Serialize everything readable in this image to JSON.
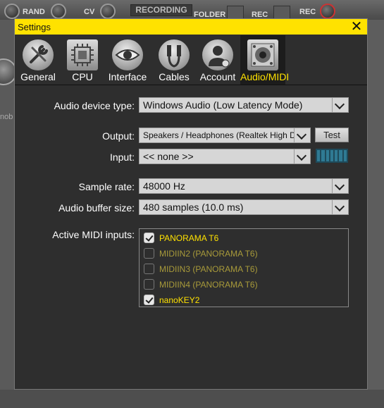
{
  "background": {
    "rand_label": "RAND",
    "cv_label": "CV",
    "recording_label": "RECORDING",
    "folder_label": "FOLDER",
    "rec_label_1": "REC",
    "rec_label_2": "REC",
    "left_partial_text": "nob"
  },
  "dialog": {
    "title": "Settings",
    "close_glyph": "✕",
    "tabs": [
      {
        "label": "General",
        "icon": "wrench-screwdriver-icon",
        "selected": false
      },
      {
        "label": "CPU",
        "icon": "cpu-chip-icon",
        "selected": false
      },
      {
        "label": "Interface",
        "icon": "eye-icon",
        "selected": false
      },
      {
        "label": "Cables",
        "icon": "cables-icon",
        "selected": false
      },
      {
        "label": "Account",
        "icon": "user-account-icon",
        "selected": false
      },
      {
        "label": "Audio/MIDI",
        "icon": "speaker-icon",
        "selected": true
      }
    ],
    "audio_device_type": {
      "label": "Audio device type:",
      "value": "Windows Audio (Low Latency Mode)"
    },
    "output": {
      "label": "Output:",
      "value": "Speakers / Headphones (Realtek High Defi...",
      "test_label": "Test"
    },
    "input": {
      "label": "Input:",
      "value": "<< none >>"
    },
    "sample_rate": {
      "label": "Sample rate:",
      "value": "48000 Hz"
    },
    "buffer_size": {
      "label": "Audio buffer size:",
      "value": "480 samples (10.0 ms)"
    },
    "midi": {
      "label": "Active MIDI inputs:",
      "items": [
        {
          "name": "PANORAMA T6",
          "checked": true
        },
        {
          "name": "MIDIIN2 (PANORAMA T6)",
          "checked": false
        },
        {
          "name": "MIDIIN3 (PANORAMA T6)",
          "checked": false
        },
        {
          "name": "MIDIIN4 (PANORAMA T6)",
          "checked": false
        },
        {
          "name": "nanoKEY2",
          "checked": true
        }
      ]
    }
  },
  "colors": {
    "accent_yellow": "#ffe200",
    "midi_enabled_text": "#ffe200",
    "midi_disabled_text": "#a89a3a",
    "meter_blue": "#2f7a93"
  }
}
